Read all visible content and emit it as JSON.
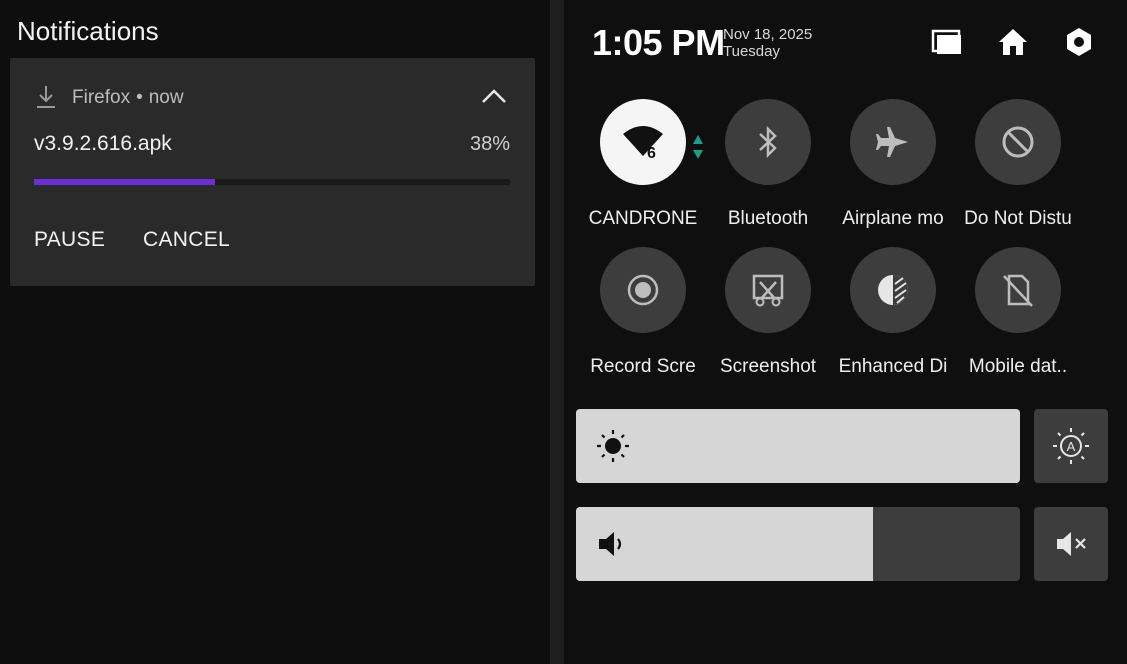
{
  "notifications": {
    "title": "Notifications",
    "card": {
      "app_name": "Firefox",
      "time": "now",
      "file_name": "v3.9.2.616.apk",
      "progress_text": "38%",
      "progress": 0.38,
      "progress_color": "#6a2fd6",
      "pause_label": "PAUSE",
      "cancel_label": "CANCEL"
    }
  },
  "status": {
    "time": "1:05 PM",
    "date": "Nov 18, 2025",
    "day": "Tuesday",
    "icons": [
      "recents-icon",
      "home-icon",
      "settings-icon"
    ]
  },
  "tiles": [
    {
      "label": "CANDRONE",
      "icon": "wifi-icon",
      "badge": "6",
      "active": true
    },
    {
      "label": "Bluetooth",
      "icon": "bluetooth-icon",
      "active": false
    },
    {
      "label": "Airplane mo",
      "icon": "airplane-icon",
      "active": false
    },
    {
      "label": "Do Not Distu",
      "icon": "do-not-disturb-icon",
      "active": false
    },
    {
      "label": "Record Scre",
      "icon": "record-icon",
      "active": false
    },
    {
      "label": "Screenshot",
      "icon": "screenshot-icon",
      "active": false
    },
    {
      "label": "Enhanced Di",
      "icon": "enhanced-display-icon",
      "active": false
    },
    {
      "label": "Mobile dat..",
      "icon": "mobile-data-off-icon",
      "active": false
    }
  ],
  "sliders": {
    "brightness": {
      "icon": "brightness-icon",
      "level": 1.0,
      "side_icon": "auto-brightness-icon"
    },
    "volume": {
      "icon": "volume-icon",
      "level": 0.67,
      "side_icon": "mute-icon"
    }
  }
}
